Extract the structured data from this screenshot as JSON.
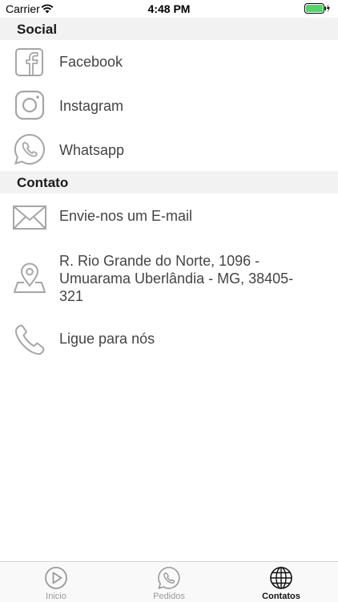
{
  "status_bar": {
    "carrier": "Carrier",
    "time": "4:48 PM"
  },
  "sections": {
    "social": {
      "title": "Social",
      "items": [
        {
          "label": "Facebook",
          "icon": "facebook-icon"
        },
        {
          "label": "Instagram",
          "icon": "instagram-icon"
        },
        {
          "label": "Whatsapp",
          "icon": "whatsapp-icon"
        }
      ]
    },
    "contato": {
      "title": "Contato",
      "items": [
        {
          "label": "Envie-nos um E-mail",
          "icon": "mail-icon"
        },
        {
          "label": "R. Rio Grande do Norte, 1096 - Umuarama Uberlândia - MG, 38405-321",
          "icon": "map-pin-icon"
        },
        {
          "label": "Ligue para nós",
          "icon": "phone-icon"
        }
      ]
    }
  },
  "tab_bar": {
    "tabs": [
      {
        "label": "Inicio",
        "icon": "play-icon"
      },
      {
        "label": "Pedidos",
        "icon": "whatsapp-icon"
      },
      {
        "label": "Contatos",
        "icon": "globe-icon"
      }
    ],
    "active_index": 2
  },
  "colors": {
    "icon_gray": "#a6a6a6",
    "section_bg": "#f2f2f2",
    "battery_green": "#4cd964"
  }
}
